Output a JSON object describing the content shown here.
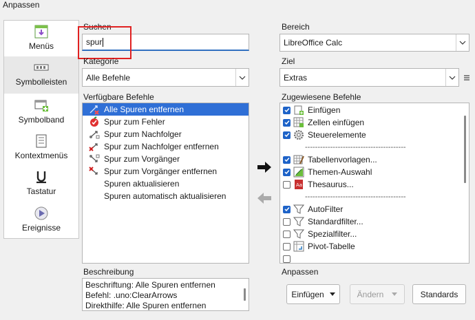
{
  "window": {
    "title": "Anpassen"
  },
  "sidebar": {
    "items": [
      {
        "label": "Menüs",
        "icon": "menu-icon"
      },
      {
        "label": "Symbolleisten",
        "icon": "toolbar-icon"
      },
      {
        "label": "Symbolband",
        "icon": "notebookbar-icon"
      },
      {
        "label": "Kontextmenüs",
        "icon": "context-menu-icon"
      },
      {
        "label": "Tastatur",
        "icon": "underline-keyboard-icon"
      },
      {
        "label": "Ereignisse",
        "icon": "events-icon"
      }
    ]
  },
  "search": {
    "label": "Suchen",
    "value": "spur"
  },
  "category": {
    "label": "Kategorie",
    "value": "Alle Befehle"
  },
  "available": {
    "label": "Verfügbare Befehle",
    "items": [
      {
        "label": "Alle Spuren entfernen",
        "icon": "clear-arrows-icon",
        "selected": true
      },
      {
        "label": "Spur zum Fehler",
        "icon": "trace-error-icon"
      },
      {
        "label": "Spur zum Nachfolger",
        "icon": "trace-dependents-icon"
      },
      {
        "label": "Spur zum Nachfolger entfernen",
        "icon": "remove-dependents-icon"
      },
      {
        "label": "Spur zum Vorgänger",
        "icon": "trace-precedents-icon"
      },
      {
        "label": "Spur zum Vorgänger entfernen",
        "icon": "remove-precedents-icon"
      },
      {
        "label": "Spuren aktualisieren",
        "icon": ""
      },
      {
        "label": "Spuren automatisch aktualisieren",
        "icon": ""
      }
    ]
  },
  "description": {
    "label": "Beschreibung",
    "line1": "Beschriftung: Alle Spuren entfernen",
    "line2": "Befehl: .uno:ClearArrows",
    "line3": "Direkthilfe: Alle Spuren entfernen"
  },
  "scope": {
    "label": "Bereich",
    "value": "LibreOffice Calc"
  },
  "target": {
    "label": "Ziel",
    "value": "Extras"
  },
  "assigned": {
    "label": "Zugewiesene Befehle",
    "separator": "----------------------------------------",
    "items": [
      {
        "type": "item",
        "label": "Einfügen",
        "checked": true,
        "icon": "insert-icon"
      },
      {
        "type": "item",
        "label": "Zellen einfügen",
        "checked": true,
        "icon": "insert-cells-icon"
      },
      {
        "type": "item",
        "label": "Steuerelemente",
        "checked": true,
        "icon": "gear-icon"
      },
      {
        "type": "separator"
      },
      {
        "type": "item",
        "label": "Tabellenvorlagen...",
        "checked": true,
        "icon": "table-styles-icon"
      },
      {
        "type": "item",
        "label": "Themen-Auswahl",
        "checked": true,
        "icon": "theme-icon"
      },
      {
        "type": "item",
        "label": "Thesaurus...",
        "checked": false,
        "icon": "thesaurus-icon"
      },
      {
        "type": "separator"
      },
      {
        "type": "item",
        "label": "AutoFilter",
        "checked": true,
        "icon": "funnel-icon"
      },
      {
        "type": "item",
        "label": "Standardfilter...",
        "checked": false,
        "icon": "funnel-icon"
      },
      {
        "type": "item",
        "label": "Spezialfilter...",
        "checked": false,
        "icon": "funnel-icon"
      },
      {
        "type": "item",
        "label": "Pivot-Tabelle",
        "checked": false,
        "icon": "pivot-table-icon"
      }
    ]
  },
  "customize": {
    "label": "Anpassen",
    "insert_label": "Einfügen",
    "modify_label": "Ändern",
    "defaults_label": "Standards"
  },
  "colors": {
    "accent": "#2f6fd6",
    "highlight_box": "#e02020"
  }
}
